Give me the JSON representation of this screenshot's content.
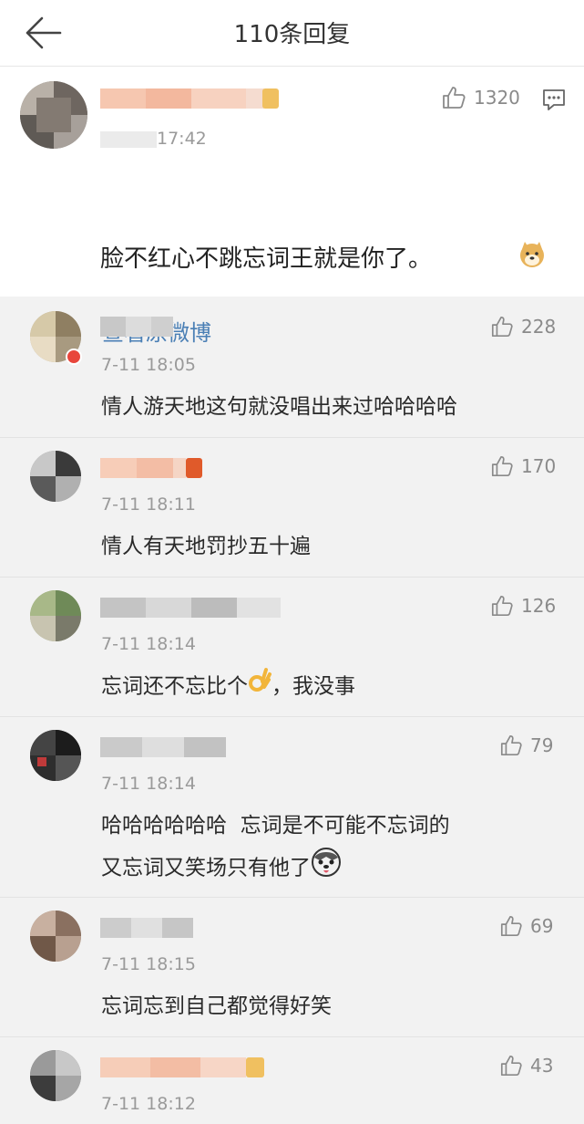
{
  "header": {
    "title": "110条回复"
  },
  "main_comment": {
    "time": "17:42",
    "likes": "1320",
    "text": "脸不红心不跳忘词王就是你了。",
    "emoji": "doge",
    "view_original": "查看原微博"
  },
  "replies": [
    {
      "time": "7-11 18:05",
      "likes": "228",
      "text": "情人游天地这句就没唱出来过哈哈哈哈"
    },
    {
      "time": "7-11 18:11",
      "likes": "170",
      "text": "情人有天地罚抄五十遍"
    },
    {
      "time": "7-11 18:14",
      "likes": "126",
      "text_before": "忘词还不忘比个",
      "emoji": "ok-hand",
      "text_after": "，我没事"
    },
    {
      "time": "7-11 18:14",
      "likes": "79",
      "line1": "哈哈哈哈哈哈  忘词是不可能不忘词的",
      "line2": "又忘词又笑场只有他了",
      "emoji": "husky"
    },
    {
      "time": "7-11 18:15",
      "likes": "69",
      "text": "忘词忘到自己都觉得好笑"
    },
    {
      "time": "7-11 18:12",
      "likes": "43"
    }
  ],
  "colors": {
    "link": "#4a7fb5",
    "time": "#9a9a9a",
    "like": "#8a8a8a",
    "background": "#f2f2f2"
  }
}
